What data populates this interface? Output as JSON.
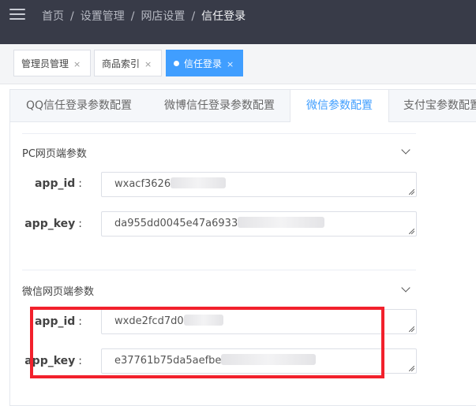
{
  "breadcrumb": {
    "items": [
      "首页",
      "设置管理",
      "网店设置"
    ],
    "current": "信任登录",
    "separator": "/"
  },
  "page_tabs": [
    {
      "label": "管理员管理",
      "close": "×",
      "active": false
    },
    {
      "label": "商品索引",
      "close": "×",
      "active": false
    },
    {
      "label": "信任登录",
      "close": "×",
      "active": true
    }
  ],
  "sub_tabs": [
    {
      "label": "QQ信任登录参数配置"
    },
    {
      "label": "微博信任登录参数配置"
    },
    {
      "label": "微信参数配置",
      "active": true
    },
    {
      "label": "支付宝参数配置"
    }
  ],
  "sections": [
    {
      "title": "PC网页端参数",
      "fields": [
        {
          "label": "app_id",
          "value": "wxacf3626"
        },
        {
          "label": "app_key",
          "value": "da955dd0045e47a6933"
        }
      ]
    },
    {
      "title": "微信网页端参数",
      "fields": [
        {
          "label": "app_id",
          "value": "wxde2fcd7d0"
        },
        {
          "label": "app_key",
          "value": "e37761b75da5aefbe"
        }
      ]
    }
  ],
  "colors": {
    "topbar": "#383b48",
    "accent": "#409eff",
    "highlight_box": "#f2212c"
  },
  "icons": [
    "menu-icon",
    "close-icon",
    "chevron-down-icon",
    "resize-grip-icon"
  ]
}
